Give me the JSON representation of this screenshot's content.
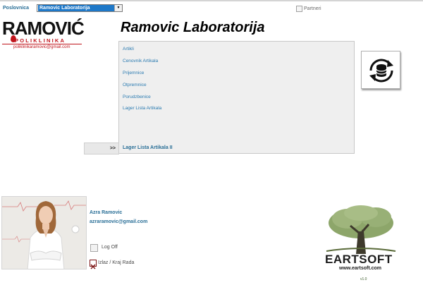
{
  "header": {
    "poslovnica_label": "Poslovnica",
    "poslovnica_value": "Ramovic Laboratorija",
    "partneri_label": "Partneri"
  },
  "logo": {
    "word": "RAMOVIĆ",
    "subtitle": "POLIKLINIKA",
    "email": "poliklinikaramovic@gmail.com"
  },
  "page_title": "Ramovic Laboratorija",
  "menu": {
    "items": [
      "Artikli",
      "Cenovnik Artikala",
      "Prijemnice",
      "Otpremnice",
      "Porudzbenice",
      "Lager Lista Artikala"
    ],
    "arrow": ">>",
    "last": "Lager Lista Artikala II"
  },
  "user": {
    "name": "Azra Ramovic",
    "email": "azraramovic@gmail.com",
    "logoff": "Log Off",
    "exit": "Izlaz / Kraj Rada"
  },
  "eartsoft": {
    "name": "EARTSOFT",
    "url": "www.eartsoft.com",
    "version": "v1.0"
  },
  "colors": {
    "link": "#2a7ab0",
    "selection": "#1e78c8",
    "brand_red": "#c0141c"
  }
}
